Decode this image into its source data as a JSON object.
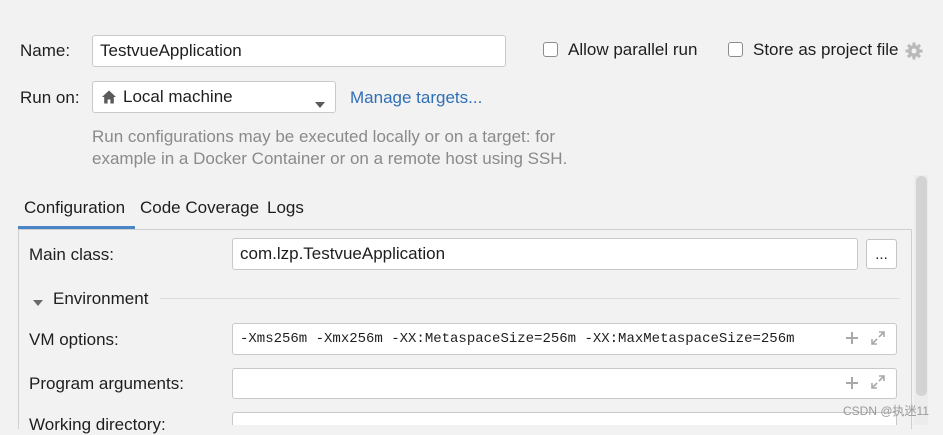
{
  "form": {
    "name_label": "Name:",
    "name_value": "TestvueApplication",
    "allow_parallel_label": "Allow parallel run",
    "store_project_label": "Store as project file",
    "run_on_label": "Run on:",
    "run_on_value": "Local machine",
    "manage_targets_label": "Manage targets...",
    "hint_line1": "Run configurations may be executed locally or on a target: for",
    "hint_line2": "example in a Docker Container or on a remote host using SSH."
  },
  "tabs": [
    {
      "label": "Configuration",
      "active": true
    },
    {
      "label": "Code Coverage",
      "active": false
    },
    {
      "label": "Logs",
      "active": false
    }
  ],
  "config": {
    "main_class_label": "Main class:",
    "main_class_value": "com.lzp.TestvueApplication",
    "browse_label": "...",
    "environment_label": "Environment",
    "vm_options_label": "VM options:",
    "vm_options_value": "-Xms256m -Xmx256m  -XX:MetaspaceSize=256m -XX:MaxMetaspaceSize=256m",
    "program_args_label": "Program arguments:",
    "program_args_value": "",
    "working_dir_label": "Working directory:"
  },
  "icons": {
    "gear": "gear-icon",
    "home": "home-icon",
    "dropdown": "chevron-down-icon",
    "triangle": "collapse-triangle-icon",
    "plus": "plus-icon",
    "expand": "expand-icon"
  },
  "colors": {
    "accent": "#4a86c7",
    "link": "#2f6fb6",
    "background": "#f2f2f2"
  },
  "watermark": "CSDN @执迷11"
}
